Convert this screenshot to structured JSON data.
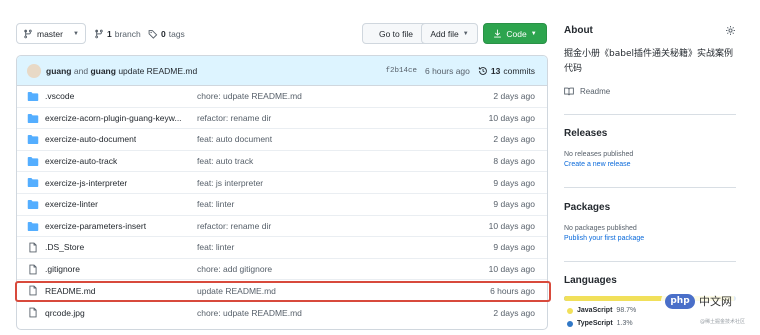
{
  "toolbar": {
    "branch": "master",
    "branches_count": "1",
    "branches_label": "branch",
    "tags_count": "0",
    "tags_label": "tags",
    "goto_file": "Go to file",
    "add_file": "Add file",
    "code": "Code"
  },
  "commit": {
    "author1": "guang",
    "and": "and",
    "author2": "guang",
    "message": "update README.md",
    "sha": "f2b14ce",
    "time": "6 hours ago",
    "count": "13",
    "count_label": "commits"
  },
  "files": [
    {
      "type": "folder",
      "name": ".vscode",
      "message": "chore: udpate README.md",
      "date": "2 days ago"
    },
    {
      "type": "folder",
      "name": "exercize-acorn-plugin-guang-keyw...",
      "message": "refactor: rename dir",
      "date": "10 days ago"
    },
    {
      "type": "folder",
      "name": "exercize-auto-document",
      "message": "feat: auto document",
      "date": "2 days ago"
    },
    {
      "type": "folder",
      "name": "exercize-auto-track",
      "message": "feat: auto track",
      "date": "8 days ago"
    },
    {
      "type": "folder",
      "name": "exercize-js-interpreter",
      "message": "feat: js interpreter",
      "date": "9 days ago"
    },
    {
      "type": "folder",
      "name": "exercize-linter",
      "message": "feat: linter",
      "date": "9 days ago"
    },
    {
      "type": "folder",
      "name": "exercize-parameters-insert",
      "message": "refactor: rename dir",
      "date": "10 days ago"
    },
    {
      "type": "file",
      "name": ".DS_Store",
      "message": "feat: linter",
      "date": "9 days ago"
    },
    {
      "type": "file",
      "name": ".gitignore",
      "message": "chore: add gitignore",
      "date": "10 days ago"
    },
    {
      "type": "file",
      "name": "README.md",
      "message": "update README.md",
      "date": "6 hours ago"
    },
    {
      "type": "file",
      "name": "qrcode.jpg",
      "message": "chore: udpate README.md",
      "date": "2 days ago"
    }
  ],
  "sidebar": {
    "about_title": "About",
    "description": "掘金小册《babel插件通关秘籍》实战案例代码",
    "readme": "Readme",
    "releases_title": "Releases",
    "releases_none": "No releases published",
    "releases_link": "Create a new release",
    "packages_title": "Packages",
    "packages_none": "No packages published",
    "packages_link": "Publish your first package",
    "languages_title": "Languages",
    "languages": [
      {
        "name": "JavaScript",
        "percent": "98.7%",
        "color": "#f1e05a",
        "fraction": 0.987
      },
      {
        "name": "TypeScript",
        "percent": "1.3%",
        "color": "#3178c6",
        "fraction": 0.013
      }
    ]
  },
  "watermark": {
    "logo": "php",
    "text": "中文网",
    "sub": "@稀土掘金技术社区"
  },
  "colors": {
    "code_button": "#2da44e",
    "highlight_border": "#d84a3c",
    "link": "#0969da",
    "folder": "#54aeff"
  }
}
